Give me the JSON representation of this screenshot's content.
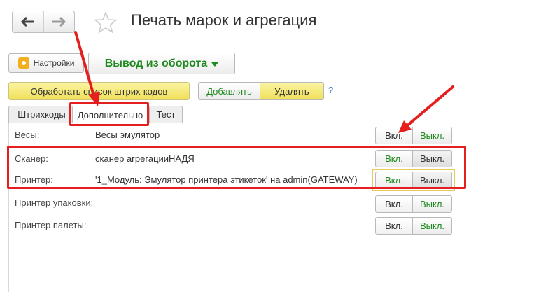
{
  "window": {
    "title": "Печать марок и агрегация"
  },
  "nav": {
    "back_icon": "arrow-left-icon",
    "forward_icon": "arrow-right-icon",
    "star_icon": "star-icon"
  },
  "toolbar": {
    "settings_label": "Настройки",
    "mode_label": "Вывод из оборота",
    "process_label": "Обработать список штрих-кодов",
    "add_label": "Добавлять",
    "delete_label": "Удалять",
    "help_label": "?"
  },
  "tabs": [
    {
      "label": "Штрихкоды"
    },
    {
      "label": "Дополнительно"
    },
    {
      "label": "Тест"
    }
  ],
  "devices": [
    {
      "label": "Весы:",
      "value": "Весы эмулятор",
      "on": "Вкл.",
      "off": "Выкл.",
      "state": "off"
    },
    {
      "label": "Сканер:",
      "value": "сканер агрегацииНАДЯ",
      "on": "Вкл.",
      "off": "Выкл.",
      "state": "on"
    },
    {
      "label": "Принтер:",
      "value": "'1_Модуль: Эмулятор принтера этикеток' на admin(GATEWAY)",
      "on": "Вкл.",
      "off": "Выкл.",
      "state": "on"
    },
    {
      "label": "Принтер упаковки:",
      "value": "",
      "on": "Вкл.",
      "off": "Выкл.",
      "state": "off"
    },
    {
      "label": "Принтер палеты:",
      "value": "",
      "on": "Вкл.",
      "off": "Выкл.",
      "state": "off"
    }
  ],
  "colors": {
    "accent_green": "#1e8a1e",
    "highlight_red": "#e51f1f",
    "yellow_button": "#f0e05a"
  }
}
